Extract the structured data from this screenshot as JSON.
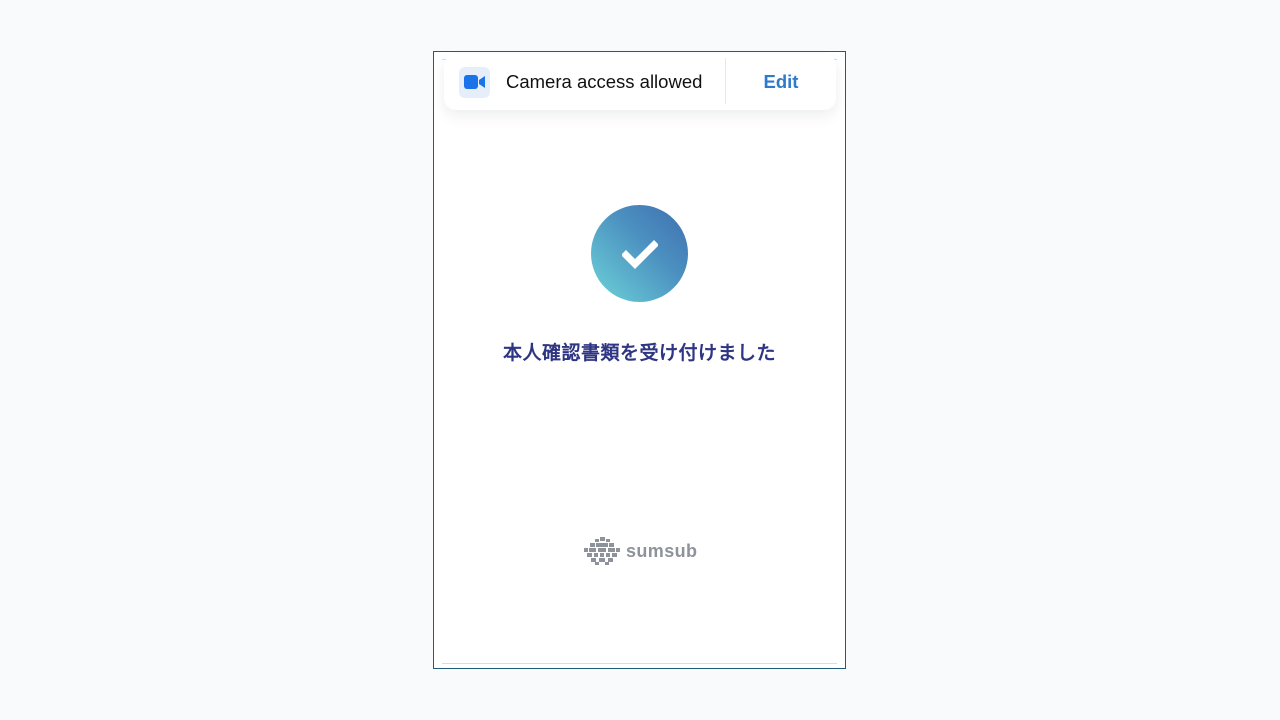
{
  "permission_banner": {
    "icon": "video-camera-icon",
    "label": "Camera access allowed",
    "edit_label": "Edit"
  },
  "verification": {
    "icon": "checkmark-icon",
    "status_text": "本人確認書類を受け付けました"
  },
  "footer": {
    "brand_icon": "sumsub-logo-icon",
    "brand_name": "sumsub"
  },
  "colors": {
    "accent_blue": "#2f7ad1",
    "title_navy": "#2e3582",
    "badge_gradient_start": "#6dd4d8",
    "badge_gradient_end": "#3f6fae",
    "brand_gray": "#8e939b"
  }
}
